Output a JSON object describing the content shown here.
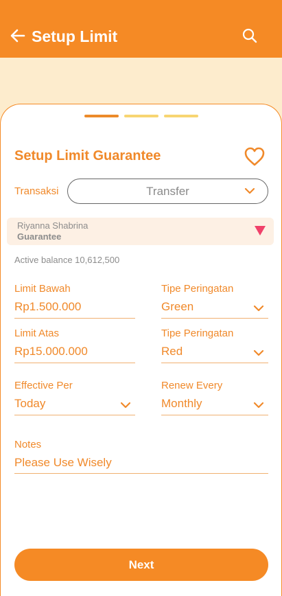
{
  "header": {
    "title": "Setup Limit",
    "back_icon": "arrow-left-icon",
    "search_icon": "search-icon"
  },
  "stepper": {
    "total_steps": 3,
    "current_step": 1
  },
  "card": {
    "title": "Setup Limit Guarantee",
    "favorite_icon": "heart-icon"
  },
  "transaksi": {
    "label": "Transaksi",
    "value": "Transfer"
  },
  "account": {
    "name": "Riyanna Shabrina",
    "type": "Guarantee",
    "balance_text": "Active balance 10,612,500"
  },
  "form": {
    "limit_bawah": {
      "label": "Limit Bawah",
      "value": "Rp1.500.000"
    },
    "tipe_peringatan_1": {
      "label": "Tipe Peringatan",
      "value": "Green"
    },
    "limit_atas": {
      "label": "Limit Atas",
      "value": "Rp15.000.000"
    },
    "tipe_peringatan_2": {
      "label": "Tipe Peringatan",
      "value": "Red"
    },
    "effective_per": {
      "label": "Effective Per",
      "value": "Today"
    },
    "renew_every": {
      "label": "Renew Every",
      "value": "Monthly"
    },
    "notes": {
      "label": "Notes",
      "value": "Please Use Wisely"
    }
  },
  "next_button": {
    "label": "Next"
  },
  "colors": {
    "primary": "#f58a25",
    "background": "#fdeccd",
    "step_inactive": "#f7d572",
    "alert_triangle": "#f0416a"
  }
}
